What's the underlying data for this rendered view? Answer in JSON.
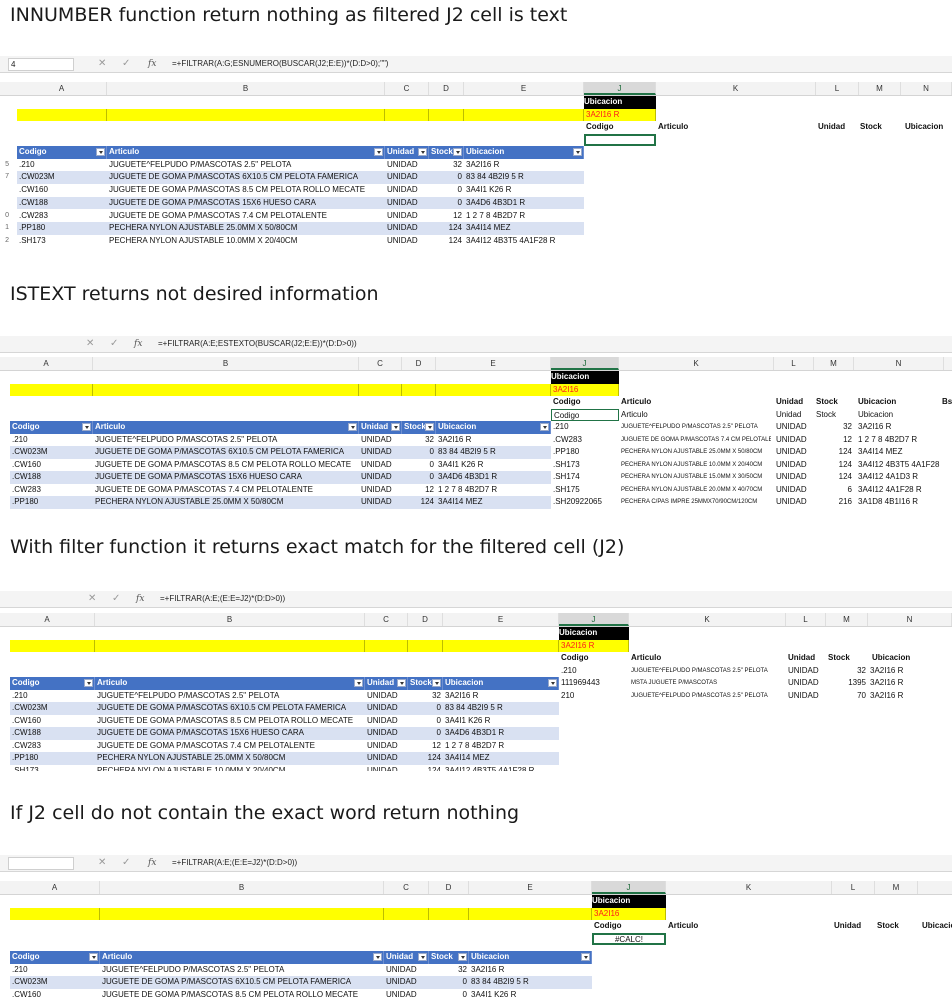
{
  "headings": [
    "INNUMBER function return nothing as filtered J2 cell is text",
    "ISTEXT returns not desired information",
    "With filter function it returns exact match for the filtered cell (J2)",
    "If J2 cell do not contain the exact word return nothing"
  ],
  "formulas": [
    "=+FILTRAR(A:G;ESNUMERO(BUSCAR(J2;E:E))*(D:D>0);\"\")",
    "=+FILTRAR(A:E;ESTEXTO(BUSCAR(J2;E:E))*(D:D>0))",
    "=+FILTRAR(A:E;(E:E=J2)*(D:D>0))",
    "=+FILTRAR(A:E;(E:E=J2)*(D:D>0))"
  ],
  "name_box": [
    "4",
    "",
    "",
    ""
  ],
  "icons": {
    "cancel": "close-icon",
    "enter": "check-icon",
    "fx": "function-icon",
    "dropdown": "chevron-down-icon"
  },
  "colors": {
    "table_header": "#4472c4",
    "band": "#d9e1f2",
    "filter_cell": "#ffff00",
    "ubicacion_header": "#000000",
    "ubicacion_value": "#ff1a1a",
    "selected_col": "#217346"
  },
  "col_letters": [
    "A",
    "B",
    "C",
    "D",
    "E",
    "J",
    "K",
    "L",
    "M",
    "N"
  ],
  "col_letters_fx": "fx",
  "table_headers": [
    "Codigo",
    "Articulo",
    "Unidad",
    "Stock",
    "Ubicacion"
  ],
  "table_rows": [
    [
      ".210",
      "JUGUETE^FELPUDO P/MASCOTAS 2.5\" PELOTA",
      "UNIDAD",
      "32",
      "3A2I16 R"
    ],
    [
      ".CW023M",
      "JUGUETE DE GOMA P/MASCOTAS 6X10.5 CM PELOTA FAMERICA",
      "UNIDAD",
      "0",
      "83 84 4B2I9 5 R"
    ],
    [
      ".CW160",
      "JUGUETE DE GOMA P/MASCOTAS 8.5 CM PELOTA ROLLO MECATE",
      "UNIDAD",
      "0",
      "3A4I1 K26 R"
    ],
    [
      ".CW188",
      "JUGUETE DE GOMA P/MASCOTAS 15X6 HUESO CARA",
      "UNIDAD",
      "0",
      "3A4D6 4B3D1 R"
    ],
    [
      ".CW283",
      "JUGUETE DE GOMA P/MASCOTAS 7.4 CM PELOTALENTE",
      "UNIDAD",
      "12",
      "1 2 7 8 4B2D7 R"
    ],
    [
      ".PP180",
      "PECHERA NYLON AJUSTABLE 25.0MM X 50/80CM",
      "UNIDAD",
      "124",
      "3A4I14 MEZ"
    ],
    [
      ".SH173",
      "PECHERA NYLON AJUSTABLE 10.0MM X 20/40CM",
      "UNIDAD",
      "124",
      "3A4I12 4B3T5 4A1F28 R"
    ]
  ],
  "ubicacion_label": "Ubicacion",
  "filter_values": [
    "3A2I16 R",
    "3A2I16",
    "3A2I16 R",
    "3A2I16"
  ],
  "right_headers": [
    "Codigo",
    "Articulo",
    "Unidad",
    "Stock",
    "Ubicacion"
  ],
  "panel2_extra_headers": [
    "Codigo",
    "Articulo",
    "Unidad",
    "Stock",
    "Ubicacion",
    "Bs"
  ],
  "panel2_results": [
    [
      ".210",
      "JUGUETE^FELPUDO P/MASCOTAS 2.5\" PELOTA",
      "UNIDAD",
      "32",
      "3A2I16 R"
    ],
    [
      ".CW283",
      "JUGUETE DE GOMA P/MASCOTAS 7.4 CM PELOTALENTE",
      "UNIDAD",
      "12",
      "1 2 7 8 4B2D7 R"
    ],
    [
      ".PP180",
      "PECHERA NYLON AJUSTABLE 25.0MM X 50/80CM",
      "UNIDAD",
      "124",
      "3A4I14 MEZ"
    ],
    [
      ".SH173",
      "PECHERA NYLON AJUSTABLE 10.0MM X 20/40CM",
      "UNIDAD",
      "124",
      "3A4I12 4B3T5 4A1F28 R"
    ],
    [
      ".SH174",
      "PECHERA NYLON AJUSTABLE 15.0MM X 30/50CM",
      "UNIDAD",
      "124",
      "3A4I12 4A1D3 R"
    ],
    [
      ".SH175",
      "PECHERA NYLON AJUSTABLE 20.0MM X 40/70CM",
      "UNIDAD",
      "6",
      "3A4I12 4A1F28 R"
    ],
    [
      ".SH20922065",
      "PECHERA C/PAS IMPRE 25MMX70/90CM/120CM",
      "UNIDAD",
      "216",
      "3A1D8 4B1I16 R"
    ]
  ],
  "panel3_results": [
    [
      ".210",
      "JUGUETE^FELPUDO P/MASCOTAS 2.5\" PELOTA",
      "UNIDAD",
      "32",
      "3A2I16 R"
    ],
    [
      "111969443",
      "MSTA JUGUETE P/MASCOTAS",
      "UNIDAD",
      "1395",
      "3A2I16 R"
    ],
    [
      "210",
      "JUGUETE^FELPUDO P/MASCOTAS 2.5\" PELOTA",
      "UNIDAD",
      "70",
      "3A2I16 R"
    ]
  ],
  "calc_error": "#CALC!",
  "row_numbers": [
    "5",
    "7",
    "",
    "",
    "0",
    "1",
    "2"
  ]
}
